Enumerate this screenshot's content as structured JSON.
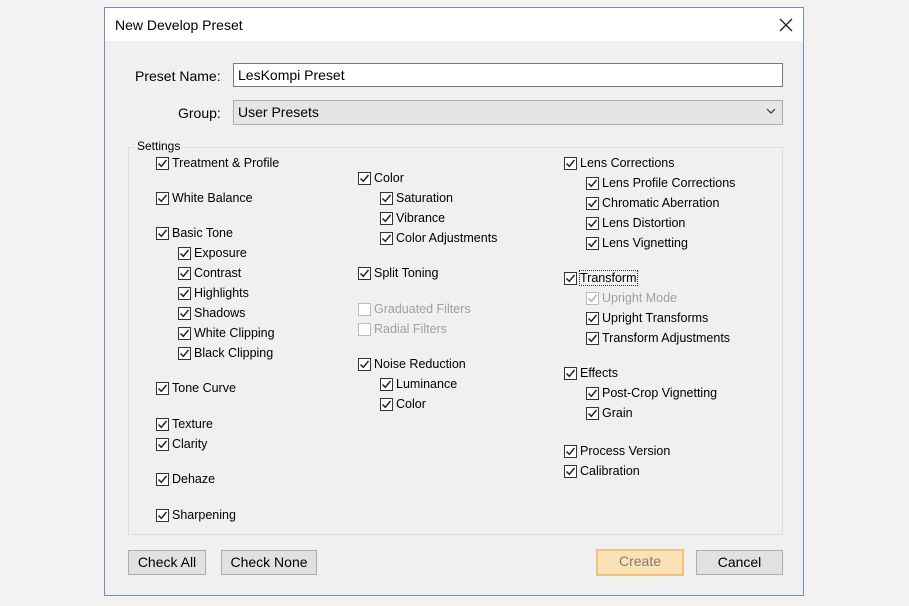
{
  "window": {
    "title": "New Develop Preset"
  },
  "form": {
    "preset_name_label": "Preset Name:",
    "preset_name_value": "LesKompi Preset",
    "group_label": "Group:",
    "group_value": "User Presets"
  },
  "settings": {
    "title": "Settings",
    "col1": [
      {
        "label": "Treatment & Profile",
        "checked": true,
        "indent": 0
      },
      {
        "label": "White Balance",
        "checked": true,
        "indent": 0
      },
      {
        "label": "Basic Tone",
        "checked": true,
        "indent": 0
      },
      {
        "label": "Exposure",
        "checked": true,
        "indent": 1
      },
      {
        "label": "Contrast",
        "checked": true,
        "indent": 1
      },
      {
        "label": "Highlights",
        "checked": true,
        "indent": 1
      },
      {
        "label": "Shadows",
        "checked": true,
        "indent": 1
      },
      {
        "label": "White Clipping",
        "checked": true,
        "indent": 1
      },
      {
        "label": "Black Clipping",
        "checked": true,
        "indent": 1
      },
      {
        "label": "Tone Curve",
        "checked": true,
        "indent": 0
      },
      {
        "label": "Texture",
        "checked": true,
        "indent": 0
      },
      {
        "label": "Clarity",
        "checked": true,
        "indent": 0
      },
      {
        "label": "Dehaze",
        "checked": true,
        "indent": 0
      },
      {
        "label": "Sharpening",
        "checked": true,
        "indent": 0
      }
    ],
    "col2": [
      {
        "label": "Color",
        "checked": true,
        "indent": 0
      },
      {
        "label": "Saturation",
        "checked": true,
        "indent": 1
      },
      {
        "label": "Vibrance",
        "checked": true,
        "indent": 1
      },
      {
        "label": "Color Adjustments",
        "checked": true,
        "indent": 1
      },
      {
        "label": "Split Toning",
        "checked": true,
        "indent": 0
      },
      {
        "label": "Graduated Filters",
        "checked": false,
        "indent": 0,
        "disabled": true
      },
      {
        "label": "Radial Filters",
        "checked": false,
        "indent": 0,
        "disabled": true
      },
      {
        "label": "Noise Reduction",
        "checked": true,
        "indent": 0
      },
      {
        "label": "Luminance",
        "checked": true,
        "indent": 1
      },
      {
        "label": "Color",
        "checked": true,
        "indent": 1
      }
    ],
    "col3": [
      {
        "label": "Lens Corrections",
        "checked": true,
        "indent": 0
      },
      {
        "label": "Lens Profile Corrections",
        "checked": true,
        "indent": 1
      },
      {
        "label": "Chromatic Aberration",
        "checked": true,
        "indent": 1
      },
      {
        "label": "Lens Distortion",
        "checked": true,
        "indent": 1
      },
      {
        "label": "Lens Vignetting",
        "checked": true,
        "indent": 1
      },
      {
        "label": "Transform",
        "checked": true,
        "indent": 0,
        "focused": true
      },
      {
        "label": "Upright Mode",
        "checked": true,
        "indent": 1,
        "disabled": true
      },
      {
        "label": "Upright Transforms",
        "checked": true,
        "indent": 1
      },
      {
        "label": "Transform Adjustments",
        "checked": true,
        "indent": 1
      },
      {
        "label": "Effects",
        "checked": true,
        "indent": 0
      },
      {
        "label": "Post-Crop Vignetting",
        "checked": true,
        "indent": 1
      },
      {
        "label": "Grain",
        "checked": true,
        "indent": 1
      },
      {
        "label": "Process Version",
        "checked": true,
        "indent": 0
      },
      {
        "label": "Calibration",
        "checked": true,
        "indent": 0
      }
    ]
  },
  "buttons": {
    "check_all": "Check All",
    "check_none": "Check None",
    "create": "Create",
    "cancel": "Cancel"
  },
  "icons": {
    "close": "close-icon",
    "dropdown": "chevron-down-icon",
    "check": "checkmark-icon"
  }
}
